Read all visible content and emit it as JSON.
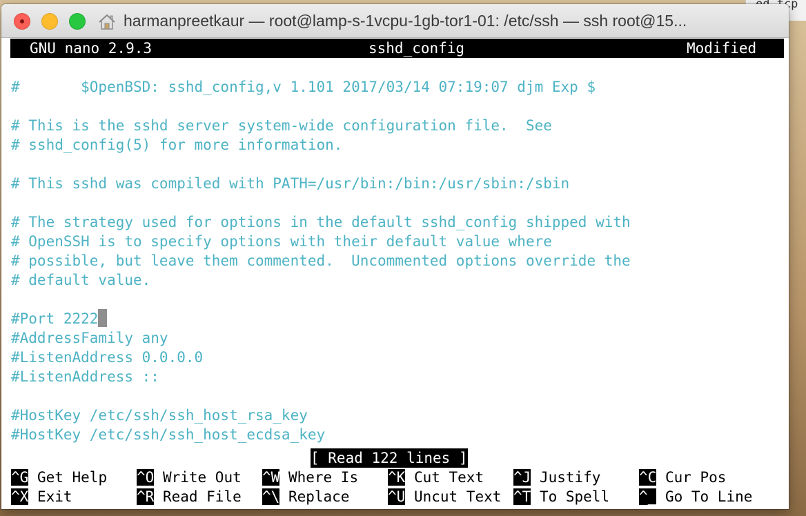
{
  "window": {
    "title": "harmanpreetkaur — root@lamp-s-1vcpu-1gb-tor1-01: /etc/ssh — ssh root@15..."
  },
  "background_window": {
    "partial_text": "ed_tcp"
  },
  "nano": {
    "version_label": "GNU nano 2.9.3",
    "filename": "sshd_config",
    "state": "Modified",
    "status_message": "[ Read 122 lines ]",
    "lines": [
      "#\t$OpenBSD: sshd_config,v 1.101 2017/03/14 07:19:07 djm Exp $",
      "",
      "# This is the sshd server system-wide configuration file.  See",
      "# sshd_config(5) for more information.",
      "",
      "# This sshd was compiled with PATH=/usr/bin:/bin:/usr/sbin:/sbin",
      "",
      "# The strategy used for options in the default sshd_config shipped with",
      "# OpenSSH is to specify options with their default value where",
      "# possible, but leave them commented.  Uncommented options override the",
      "# default value.",
      "",
      "#Port 2222",
      "#AddressFamily any",
      "#ListenAddress 0.0.0.0",
      "#ListenAddress ::",
      "",
      "#HostKey /etc/ssh/ssh_host_rsa_key",
      "#HostKey /etc/ssh/ssh_host_ecdsa_key"
    ],
    "shortcuts": [
      {
        "key": "^G",
        "label": "Get Help"
      },
      {
        "key": "^O",
        "label": "Write Out"
      },
      {
        "key": "^W",
        "label": "Where Is"
      },
      {
        "key": "^K",
        "label": "Cut Text"
      },
      {
        "key": "^J",
        "label": "Justify"
      },
      {
        "key": "^C",
        "label": "Cur Pos"
      },
      {
        "key": "^X",
        "label": "Exit"
      },
      {
        "key": "^R",
        "label": "Read File"
      },
      {
        "key": "^\\",
        "label": "Replace"
      },
      {
        "key": "^U",
        "label": "Uncut Text"
      },
      {
        "key": "^T",
        "label": "To Spell"
      },
      {
        "key": "^_",
        "label": "Go To Line"
      }
    ]
  },
  "colors": {
    "comment_text": "#4db3c4",
    "header_bg": "#000000",
    "cursor": "#8e8e8e"
  }
}
